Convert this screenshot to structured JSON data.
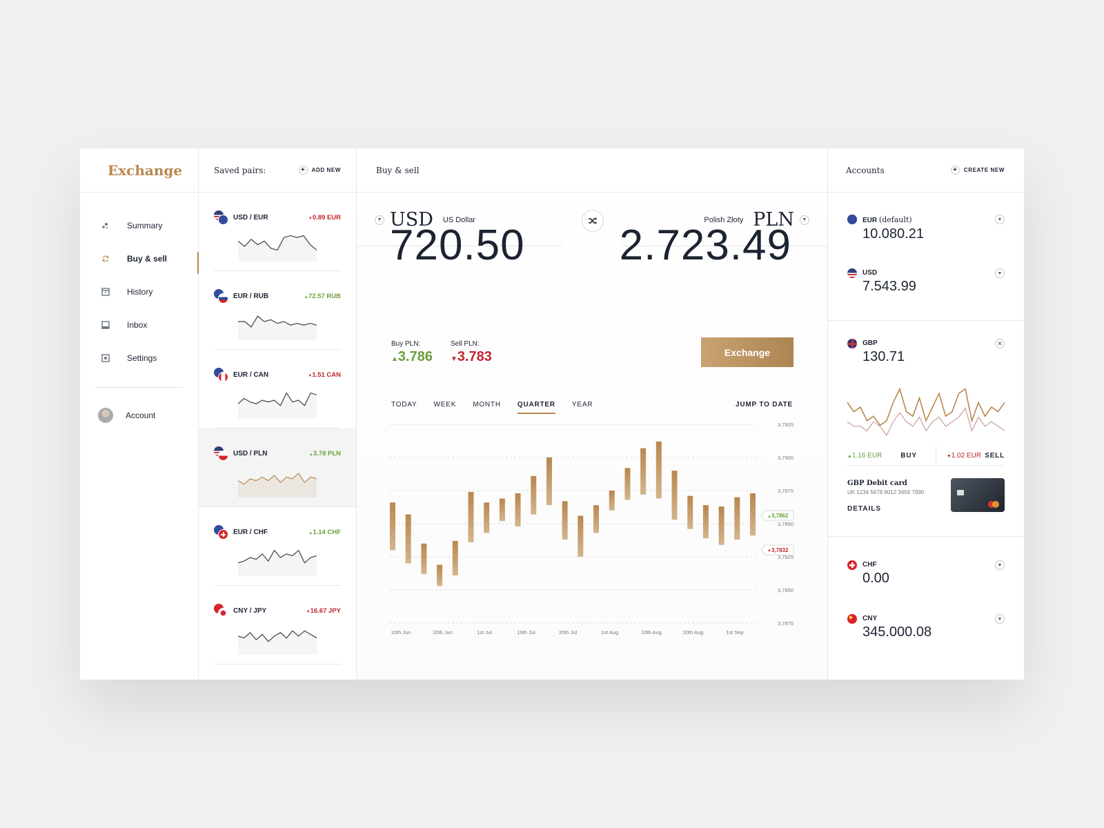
{
  "brand": "Exchange",
  "nav": {
    "items": [
      {
        "label": "Summary",
        "icon": "summary-icon"
      },
      {
        "label": "Buy & sell",
        "icon": "swap-icon",
        "active": true
      },
      {
        "label": "History",
        "icon": "history-icon"
      },
      {
        "label": "Inbox",
        "icon": "inbox-icon"
      },
      {
        "label": "Settings",
        "icon": "settings-icon"
      }
    ],
    "account_label": "Account"
  },
  "pairs": {
    "title": "Saved pairs:",
    "add_label": "ADD NEW",
    "items": [
      {
        "name": "USD / EUR",
        "change": "0.89 EUR",
        "direction": "down",
        "spark": [
          6,
          3,
          7,
          4,
          6,
          2,
          1,
          8,
          9,
          8,
          9,
          4,
          1
        ],
        "selected": false
      },
      {
        "name": "EUR / RUB",
        "change": "72.57 RUB",
        "direction": "up",
        "spark": [
          5,
          5,
          2,
          8,
          5,
          6,
          4,
          5,
          3,
          4,
          3,
          4,
          3
        ],
        "selected": false
      },
      {
        "name": "EUR / CAN",
        "change": "1.51 CAN",
        "direction": "down",
        "spark": [
          3,
          6,
          4,
          3,
          5,
          4,
          5,
          2,
          9,
          4,
          5,
          2,
          9,
          8
        ],
        "selected": false
      },
      {
        "name": "USD / PLN",
        "change": "3.78 PLN",
        "direction": "up",
        "spark": [
          4,
          2,
          5,
          4,
          6,
          4,
          7,
          3,
          6,
          5,
          8,
          3,
          6,
          5
        ],
        "selected": true
      },
      {
        "name": "EUR / CHF",
        "change": "1.14 CHF",
        "direction": "up",
        "spark": [
          2,
          3,
          5,
          4,
          7,
          3,
          9,
          5,
          7,
          6,
          9,
          2,
          5,
          6
        ],
        "selected": false
      },
      {
        "name": "CNY / JPY",
        "change": "16.67 JPY",
        "direction": "down",
        "spark": [
          5,
          4,
          7,
          3,
          6,
          2,
          5,
          7,
          4,
          8,
          5,
          8,
          6,
          4
        ],
        "selected": false
      }
    ]
  },
  "main": {
    "header": "Buy & sell",
    "from": {
      "code": "USD",
      "name": "US Dollar",
      "amount": "720.50"
    },
    "to": {
      "code": "PLN",
      "name": "Polish Złoty",
      "amount": "2.723.49"
    },
    "buy_label": "Buy PLN:",
    "buy_value": "3.786",
    "sell_label": "Sell PLN:",
    "sell_value": "3.783",
    "exchange_button": "Exchange",
    "tabs": [
      "TODAY",
      "WEEK",
      "MONTH",
      "QUARTER",
      "YEAR"
    ],
    "active_tab": "QUARTER",
    "jump_label": "JUMP TO DATE"
  },
  "chart_data": {
    "type": "bar",
    "subtype": "floating-range",
    "x_tick_labels": [
      "10th Jun",
      "20th Jun",
      "1st Jul",
      "10th Jul",
      "20th Jul",
      "1st Aug",
      "10th Aug",
      "20th Aug",
      "1st Sep"
    ],
    "y_tick_labels": [
      "3,7925",
      "3,7900",
      "3,7875",
      "3,7850",
      "3,7825",
      "3,7850",
      "3,7875"
    ],
    "markers": [
      {
        "label": "3,7862",
        "direction": "up"
      },
      {
        "label": "3,7832",
        "direction": "down"
      }
    ],
    "ranges": [
      [
        3.7866,
        3.783
      ],
      [
        3.7857,
        3.782
      ],
      [
        3.7835,
        3.7812
      ],
      [
        3.7819,
        3.7803
      ],
      [
        3.7837,
        3.7811
      ],
      [
        3.7874,
        3.7836
      ],
      [
        3.7866,
        3.7843
      ],
      [
        3.7869,
        3.7852
      ],
      [
        3.7873,
        3.7848
      ],
      [
        3.7886,
        3.7857
      ],
      [
        3.79,
        3.7864
      ],
      [
        3.7867,
        3.7838
      ],
      [
        3.7856,
        3.7825
      ],
      [
        3.7864,
        3.7843
      ],
      [
        3.7875,
        3.786
      ],
      [
        3.7892,
        3.7868
      ],
      [
        3.7907,
        3.7872
      ],
      [
        3.7912,
        3.7869
      ],
      [
        3.789,
        3.7853
      ],
      [
        3.7871,
        3.7846
      ],
      [
        3.7864,
        3.7839
      ],
      [
        3.7863,
        3.7834
      ],
      [
        3.787,
        3.7838
      ],
      [
        3.7873,
        3.7841
      ]
    ],
    "color": "#b8874f"
  },
  "accounts": {
    "title": "Accounts",
    "create_label": "CREATE NEW",
    "items": [
      {
        "code": "EUR",
        "note": "(default)",
        "balance": "10.080.21"
      },
      {
        "code": "USD",
        "balance": "7.543.99"
      },
      {
        "code": "GBP",
        "balance": "130.71"
      },
      {
        "code": "CHF",
        "balance": "0.00"
      },
      {
        "code": "CNY",
        "balance": "345.000.08"
      }
    ],
    "gbp": {
      "buy_change": "1.16 EUR",
      "buy_label": "BUY",
      "sell_change": "1.02 EUR",
      "sell_label": "SELL",
      "card_title": "GBP Debit card",
      "card_number": "UK 1234 5678 9012 3456 7890",
      "details_label": "DETAILS",
      "line_a": [
        6,
        4,
        5,
        2,
        3,
        1,
        2,
        6,
        9,
        4,
        3,
        7,
        2,
        5,
        8,
        3,
        4,
        8,
        9,
        2,
        6,
        3,
        5,
        4,
        6
      ],
      "line_b": [
        3,
        2,
        2,
        1,
        3,
        2,
        0,
        3,
        5,
        3,
        2,
        4,
        1,
        3,
        4,
        2,
        3,
        4,
        6,
        1,
        4,
        2,
        3,
        2,
        1
      ]
    }
  },
  "colors": {
    "accent": "#b8874f",
    "up": "#6a9f3c",
    "down": "#c0262d",
    "ink": "#1c2331"
  }
}
